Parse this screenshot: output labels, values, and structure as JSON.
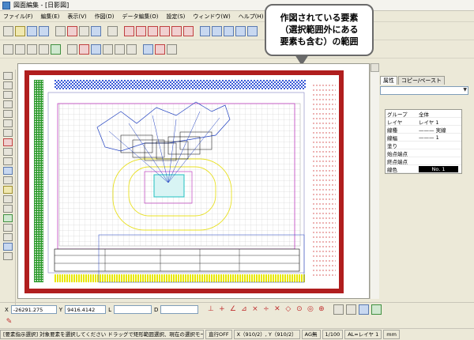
{
  "window": {
    "title": "図面編集 - [日影図]"
  },
  "menubar": {
    "items": [
      "ファイル(F)",
      "編集(E)",
      "表示(V)",
      "作図(D)",
      "データ編集(O)",
      "設定(S)",
      "ウィンドウ(W)",
      "ヘルプ(H)"
    ]
  },
  "tooltip": {
    "line1": "作図されている要素",
    "line2": "（選択範囲外にある",
    "line3": "要素も含む）の範囲"
  },
  "panel": {
    "tabs": [
      "属性",
      "コピー/ペースト"
    ],
    "rows": [
      {
        "key": "グループ",
        "value": "全体"
      },
      {
        "key": "レイヤ",
        "value": "レイヤ 1"
      },
      {
        "key": "線種",
        "value": "——— 実線"
      },
      {
        "key": "線幅",
        "value": "——— 1"
      },
      {
        "key": "塗り",
        "value": ""
      },
      {
        "key": "始点端点",
        "value": ""
      },
      {
        "key": "終点端点",
        "value": ""
      },
      {
        "key": "線色",
        "value": "No. 1"
      }
    ]
  },
  "coords": {
    "x_label": "X",
    "x_value": "-26291.275",
    "y_label": "Y",
    "y_value": "9416.4142",
    "l_label": "L",
    "d_label": "D"
  },
  "status": {
    "message": "[要素指示選択] 対象要素を選択してください ドラッグで矩形範囲選択、現在の選択モードは最小グループ要素です。",
    "grid": "直行OFF",
    "xy": "X（910/2）, Y（910/2）",
    "mode": "AG無",
    "scale": "1/100",
    "layer": "AL=レイヤ 1",
    "unit": "mm"
  }
}
